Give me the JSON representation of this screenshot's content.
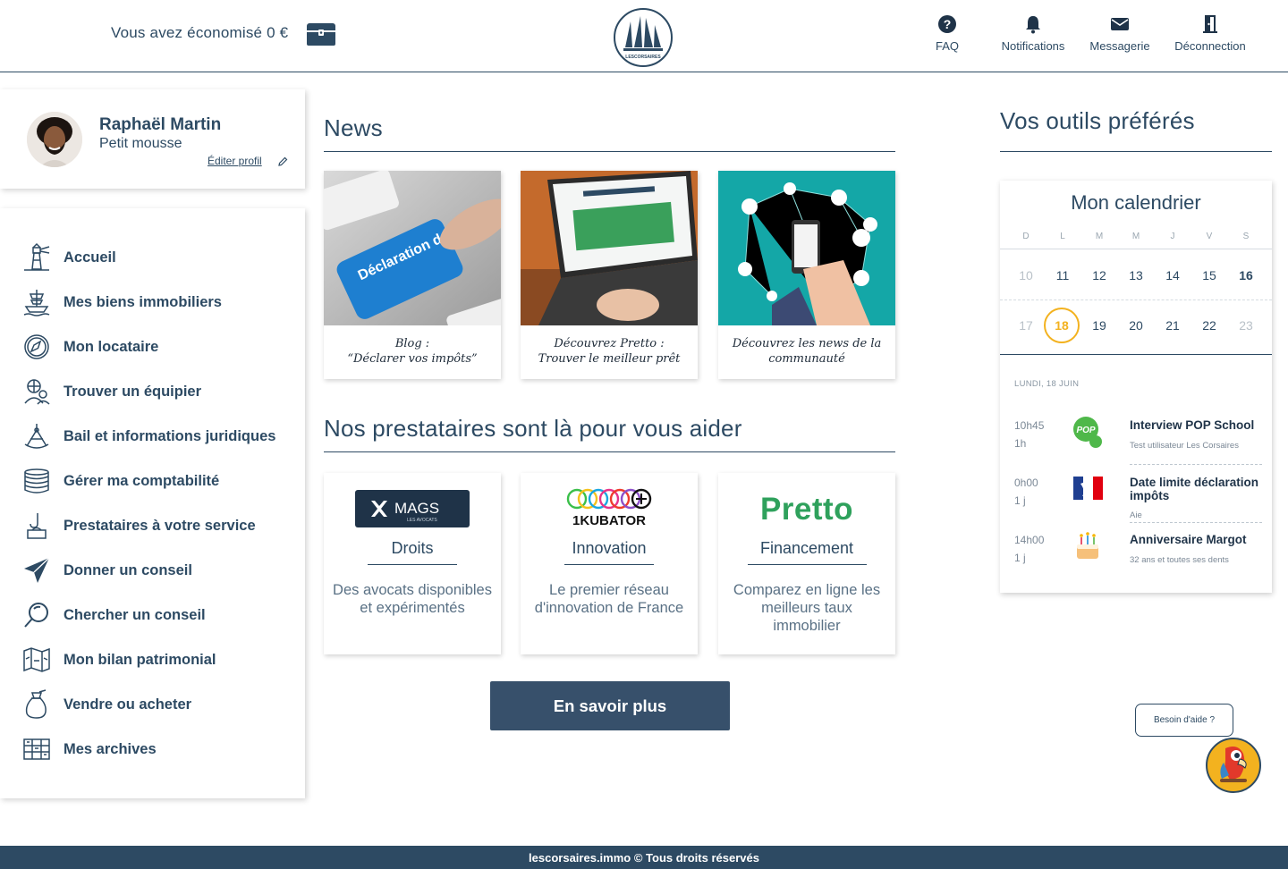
{
  "header": {
    "savings_text": "Vous avez économisé 0 €",
    "logo_text": "LESCORSAIRES",
    "links": [
      {
        "label": "FAQ",
        "icon": "question-circle-icon"
      },
      {
        "label": "Notifications",
        "icon": "bell-icon"
      },
      {
        "label": "Messagerie",
        "icon": "envelope-icon"
      },
      {
        "label": "Déconnection",
        "icon": "door-exit-icon"
      }
    ]
  },
  "profile": {
    "name": "Raphaël Martin",
    "rank": "Petit mousse",
    "edit_label": "Éditer profil"
  },
  "sidebar": {
    "items": [
      {
        "label": "Accueil",
        "icon": "lighthouse-icon"
      },
      {
        "label": "Mes biens immobiliers",
        "icon": "ship-icon"
      },
      {
        "label": "Mon locataire",
        "icon": "compass-icon"
      },
      {
        "label": "Trouver un équipier",
        "icon": "crew-icon"
      },
      {
        "label": "Bail et informations juridiques",
        "icon": "sextant-icon"
      },
      {
        "label": "Gérer ma comptabilité",
        "icon": "coins-icon"
      },
      {
        "label": "Prestataires à votre service",
        "icon": "hook-icon"
      },
      {
        "label": "Donner un conseil",
        "icon": "paper-plane-icon"
      },
      {
        "label": "Chercher un conseil",
        "icon": "magnifier-icon"
      },
      {
        "label": "Mon bilan patrimonial",
        "icon": "map-icon"
      },
      {
        "label": "Vendre ou acheter",
        "icon": "money-bag-icon"
      },
      {
        "label": "Mes archives",
        "icon": "archive-icon"
      }
    ]
  },
  "news": {
    "title": "News",
    "cards": [
      {
        "line1": "Blog :",
        "line2": "“Déclarer vos impôts”",
        "image_text": "Déclaration de revenus"
      },
      {
        "line1": "Découvrez Pretto :",
        "line2": "Trouver le meilleur prêt"
      },
      {
        "line1": "Découvrez les news de la",
        "line2": "communauté"
      }
    ]
  },
  "providers": {
    "title": "Nos prestataires sont là pour vous aider",
    "cards": [
      {
        "logo": "MAGS",
        "logo_sub": "LES AVOCATS",
        "category": "Droits",
        "description": "Des avocats disponibles et expérimentés"
      },
      {
        "logo": "1KUBATOR",
        "category": "Innovation",
        "description": "Le premier réseau d'innovation de France"
      },
      {
        "logo": "Pretto",
        "category": "Financement",
        "description": "Comparez en ligne les meilleurs taux immobilier"
      }
    ],
    "cta_label": "En savoir plus"
  },
  "tools": {
    "title": "Vos outils préférés",
    "calendar": {
      "title": "Mon calendrier",
      "weekdays": [
        "D",
        "L",
        "M",
        "M",
        "J",
        "V",
        "S"
      ],
      "week1": [
        "10",
        "11",
        "12",
        "13",
        "14",
        "15",
        "16"
      ],
      "week2": [
        "17",
        "18",
        "19",
        "20",
        "21",
        "22",
        "23"
      ],
      "today": "18",
      "selected_date": "LUNDI, 18 JUIN",
      "events": [
        {
          "time": "10h45",
          "duration": "1h",
          "title": "Interview POP School",
          "subtitle": "Test utilisateur Les Corsaires",
          "icon": "pop-school-logo-icon"
        },
        {
          "time": "0h00",
          "duration": "1 j",
          "title": "Date limite déclaration impôts",
          "subtitle": "Aie",
          "icon": "marianne-logo-icon"
        },
        {
          "time": "14h00",
          "duration": "1 j",
          "title": "Anniversaire Margot",
          "subtitle": "32 ans et toutes ses dents",
          "icon": "birthday-cake-icon"
        }
      ]
    }
  },
  "help": {
    "label": "Besoin d'aide ?"
  },
  "footer": {
    "text": "lescorsaires.immo © Tous droits réservés"
  },
  "colors": {
    "primary": "#2d4a63",
    "accent": "#f3b21f",
    "pretto_green": "#2fa15c",
    "button": "#37506b"
  }
}
